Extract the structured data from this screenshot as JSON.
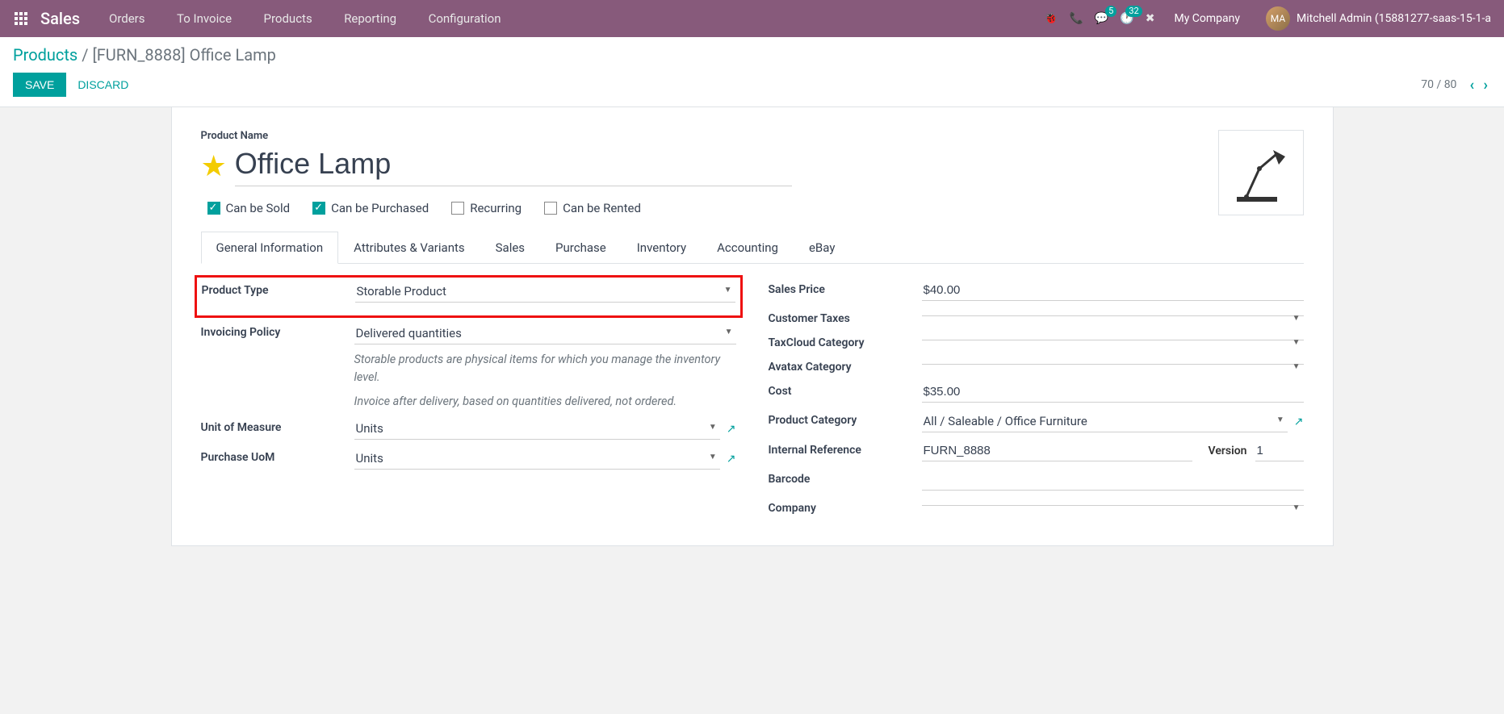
{
  "topnav": {
    "brand": "Sales",
    "menu": [
      "Orders",
      "To Invoice",
      "Products",
      "Reporting",
      "Configuration"
    ],
    "msg_badge": "5",
    "activity_badge": "32",
    "company": "My Company",
    "user": "Mitchell Admin (15881277-saas-15-1-a"
  },
  "breadcrumb": {
    "parent": "Products",
    "current": "[FURN_8888] Office Lamp"
  },
  "buttons": {
    "save": "SAVE",
    "discard": "DISCARD"
  },
  "pager": {
    "text": "70 / 80"
  },
  "product": {
    "label": "Product Name",
    "name": "Office Lamp",
    "checkboxes": {
      "can_be_sold": "Can be Sold",
      "can_be_purchased": "Can be Purchased",
      "recurring": "Recurring",
      "can_be_rented": "Can be Rented"
    }
  },
  "tabs": [
    "General Information",
    "Attributes & Variants",
    "Sales",
    "Purchase",
    "Inventory",
    "Accounting",
    "eBay"
  ],
  "left": {
    "product_type": {
      "label": "Product Type",
      "value": "Storable Product"
    },
    "invoicing_policy": {
      "label": "Invoicing Policy",
      "value": "Delivered quantities"
    },
    "help1": "Storable products are physical items for which you manage the inventory level.",
    "help2": "Invoice after delivery, based on quantities delivered, not ordered.",
    "uom": {
      "label": "Unit of Measure",
      "value": "Units"
    },
    "purchase_uom": {
      "label": "Purchase UoM",
      "value": "Units"
    }
  },
  "right": {
    "sales_price": {
      "label": "Sales Price",
      "value": "$40.00"
    },
    "customer_taxes": {
      "label": "Customer Taxes",
      "value": ""
    },
    "taxcloud": {
      "label": "TaxCloud Category",
      "value": ""
    },
    "avatax": {
      "label": "Avatax Category",
      "value": ""
    },
    "cost": {
      "label": "Cost",
      "value": "$35.00"
    },
    "category": {
      "label": "Product Category",
      "value": "All / Saleable / Office Furniture"
    },
    "internal_ref": {
      "label": "Internal Reference",
      "value": "FURN_8888"
    },
    "version": {
      "label": "Version",
      "value": "1"
    },
    "barcode": {
      "label": "Barcode",
      "value": ""
    },
    "company": {
      "label": "Company",
      "value": ""
    }
  }
}
